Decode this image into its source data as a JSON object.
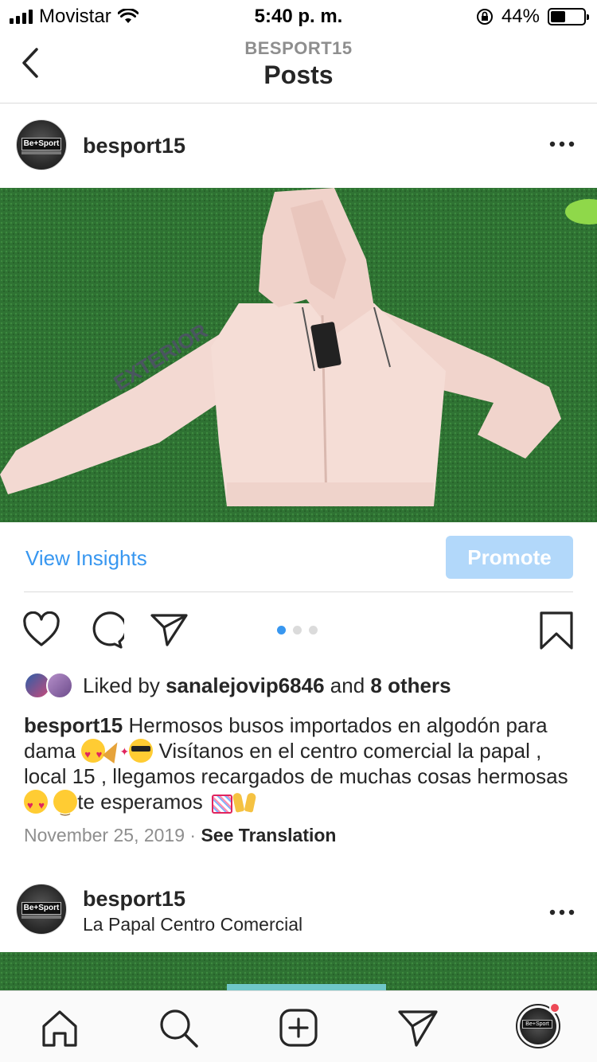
{
  "status_bar": {
    "carrier": "Movistar",
    "time": "5:40 p. m.",
    "battery": "44%",
    "battery_level": 0.44
  },
  "nav": {
    "subtitle": "BESPORT15",
    "title": "Posts",
    "back_icon": "chevron-left-icon"
  },
  "post1": {
    "username": "besport15",
    "avatar_text": "Be+Sport",
    "more_icon": "more-horizontal-icon",
    "insights_label": "View Insights",
    "promote_label": "Promote",
    "carousel": {
      "count": 3,
      "active_index": 0
    },
    "likes": {
      "prefix": "Liked by",
      "user": "sanalejovip6846",
      "and": "and",
      "others": "8 others"
    },
    "caption": {
      "username": "besport15",
      "text1": "Hermosos busos importados en algodón para dama",
      "text2": "Visítanos en el centro comercial la papal , local 15 , llegamos recargados de muchas cosas hermosas",
      "text3": "te esperamos"
    },
    "date": "November 25, 2019",
    "separator": "·",
    "see_translation": "See Translation"
  },
  "post2": {
    "username": "besport15",
    "location": "La Papal Centro Comercial",
    "avatar_text": "Be+Sport"
  },
  "tab_bar": {
    "icons": [
      "home-icon",
      "search-icon",
      "new-post-icon",
      "direct-icon",
      "profile-icon"
    ]
  },
  "colors": {
    "accent": "#3897f0",
    "promote_bg": "#b2d8fa",
    "notification": "#ed4956",
    "text": "#262626",
    "muted": "#8e8e8e"
  }
}
